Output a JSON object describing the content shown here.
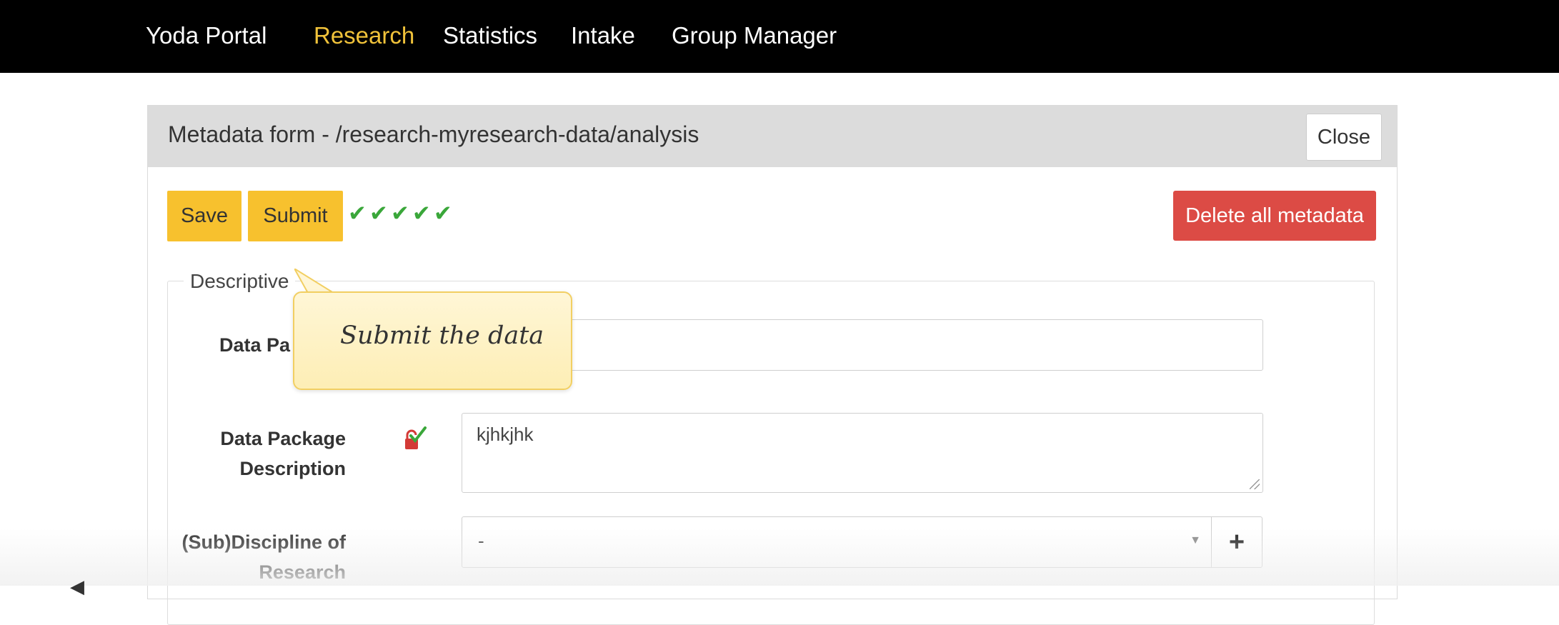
{
  "nav": {
    "brand": "Yoda Portal",
    "items": [
      {
        "label": "Research",
        "active": true
      },
      {
        "label": "Statistics",
        "active": false
      },
      {
        "label": "Intake",
        "active": false
      },
      {
        "label": "Group Manager",
        "active": false
      }
    ]
  },
  "panel": {
    "title": "Metadata form - /research-myresearch-data/analysis",
    "close_label": "Close"
  },
  "toolbar": {
    "save_label": "Save",
    "submit_label": "Submit",
    "checks": "✔✔✔✔✔",
    "delete_label": "Delete all metadata"
  },
  "fieldset": {
    "legend": "Descriptive"
  },
  "fields": {
    "title_label": "Data Pa",
    "description_label_line1": "Data Package",
    "description_label_line2": "Description",
    "description_value": "kjhkjhk",
    "discipline_label_line1": "(Sub)Discipline of",
    "discipline_label_line2": "Research",
    "discipline_value": "-",
    "add_symbol": "+"
  },
  "tooltip": {
    "text": "Submit the data"
  },
  "colors": {
    "navbar_bg": "#000000",
    "nav_active": "#f0c23a",
    "button_yellow": "#f7c12e",
    "button_danger": "#dc4b45",
    "check_green": "#3aa73a"
  }
}
